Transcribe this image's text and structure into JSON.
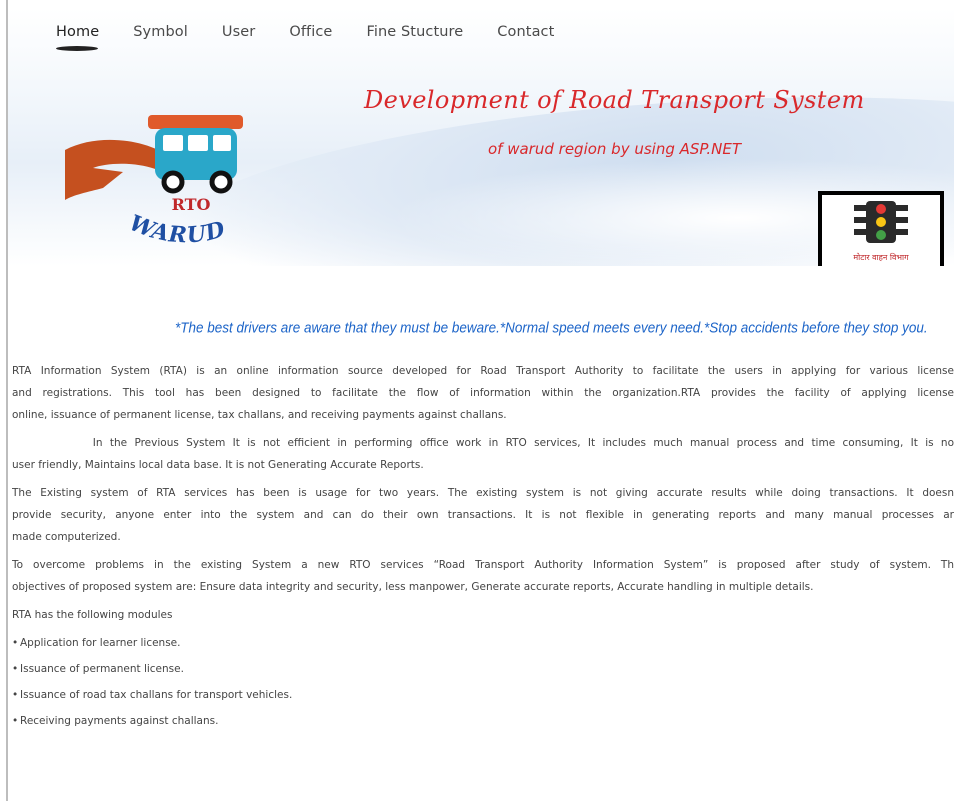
{
  "nav": {
    "items": [
      "Home",
      "Symbol",
      "User",
      "Office",
      "Fine Stucture",
      "Contact"
    ],
    "active": "Home"
  },
  "header": {
    "title": "Development of Road Transport System",
    "subtitle": "of warud region by using ASP.NET",
    "logo_badge": "RTO",
    "logo_text": "WARUD",
    "signal_caption": "मोटार वाहन विभाग"
  },
  "quote": "*The best drivers are aware that they must be beware.*Normal speed meets every need.*Stop accidents before they stop you.",
  "paragraphs": [
    {
      "lines": [
        " RTA Information System (RTA) is an online information source developed for Road Transport Authority to facilitate the users in applying for various license",
        "and registrations. This tool has been designed to facilitate the flow of information within the organization.RTA provides the facility of applying license",
        "online, issuance of permanent license, tax challans, and receiving payments against challans."
      ]
    },
    {
      "lines": [
        "           In the Previous System It is not efficient in performing office work in RTO services, It includes much manual process and time consuming, It is no",
        "user friendly, Maintains local data base. It is not Generating Accurate Reports."
      ]
    },
    {
      "lines": [
        " The Existing system of RTA services has been is usage for two years. The existing system is not giving accurate results while doing transactions. It doesn",
        "provide security, anyone enter into the system and can do their own transactions. It is not flexible in generating reports and many manual processes ar",
        "made computerized."
      ]
    },
    {
      "lines": [
        "To overcome problems in the existing System a  new RTO services “Road Transport Authority Information System” is proposed after study of system. Th",
        "objectives of proposed system are: Ensure data integrity and security, less manpower, Generate accurate reports, Accurate handling in multiple details."
      ]
    },
    {
      "lines": [
        "RTA has the following modules"
      ]
    }
  ],
  "modules": [
    "Application for learner license.",
    "Issuance of permanent license.",
    "Issuance of road tax challans for transport vehicles.",
    "Receiving payments against challans."
  ],
  "colors": {
    "title_red": "#d9282b",
    "quote_blue": "#1c64c8",
    "car_teal": "#2aa7c9",
    "roof_orange": "#e05a2b",
    "road_brown": "#c5501f",
    "warud_blue": "#1f4fa3"
  }
}
